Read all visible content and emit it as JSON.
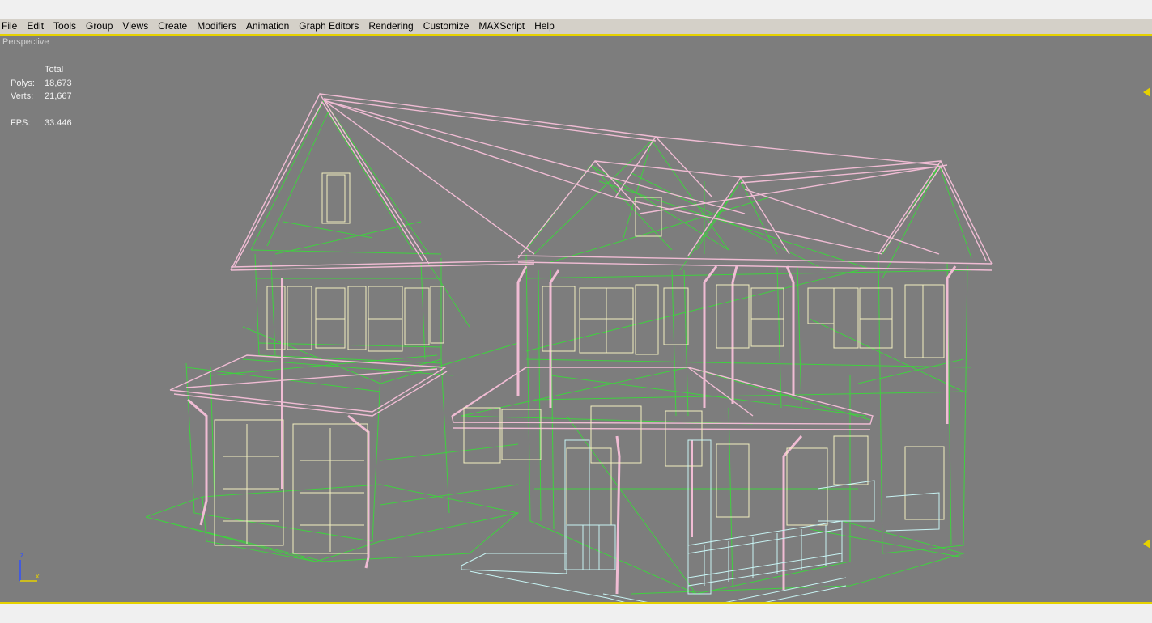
{
  "menu": {
    "items": [
      "File",
      "Edit",
      "Tools",
      "Group",
      "Views",
      "Create",
      "Modifiers",
      "Animation",
      "Graph Editors",
      "Rendering",
      "Customize",
      "MAXScript",
      "Help"
    ]
  },
  "viewport": {
    "label": "Perspective",
    "stats": {
      "header": "Total",
      "polys_label": "Polys:",
      "polys_value": "18,673",
      "verts_label": "Verts:",
      "verts_value": "21,667",
      "fps_label": "FPS:",
      "fps_value": "33.446"
    },
    "axis": {
      "z_label": "z",
      "x_label": "x"
    }
  },
  "colors": {
    "viewport_bg": "#7d7d7d",
    "active_border": "#e6d200",
    "wire_green": "#3fd13f",
    "wire_pink": "#f0bcd4",
    "wire_cream": "#f2f0c0",
    "wire_cyan": "#c8f4f4"
  },
  "icons": [
    "viewport-axis-icon",
    "time-slider-marker-icon"
  ]
}
